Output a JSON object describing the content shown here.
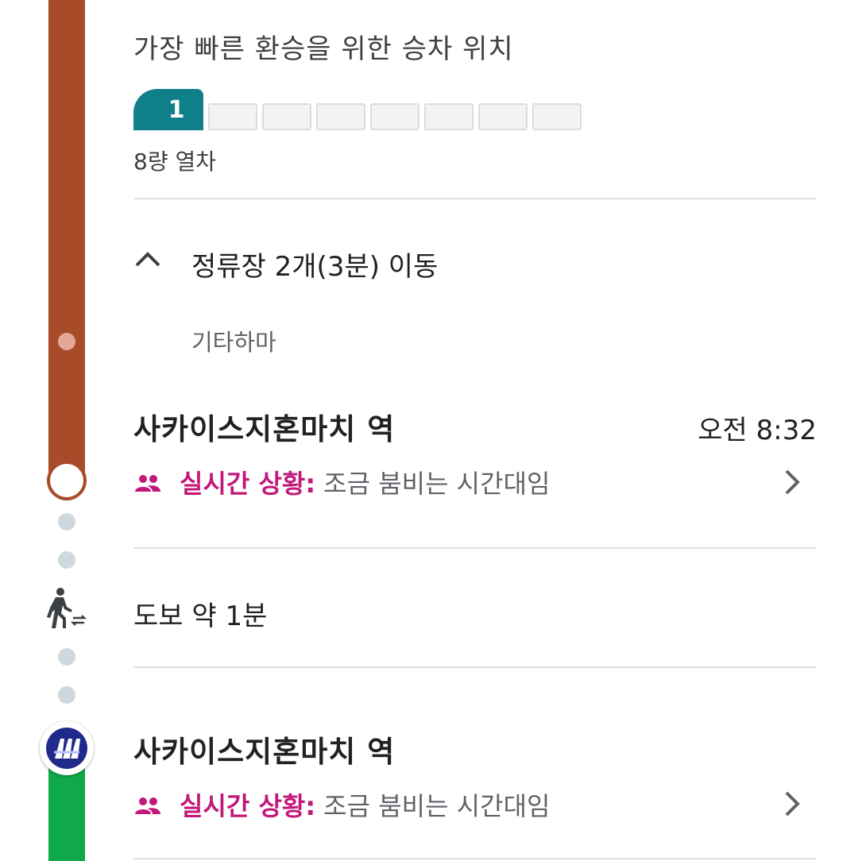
{
  "boarding_section": {
    "title": "가장 빠른 환승을 위한 승차 위치",
    "highlighted_car": "1",
    "total_cars": 8,
    "cars_label": "8량 열차"
  },
  "intermediate": {
    "toggle_label": "정류장 2개(3분) 이동",
    "stops": [
      "기타하마"
    ]
  },
  "arrival_stop": {
    "name": "사카이스지혼마치 역",
    "time": "오전 8:32",
    "status_label": "실시간 상황:",
    "status_value": "조금 붐비는 시간대임"
  },
  "walk": {
    "label": "도보 약 1분"
  },
  "transfer_stop": {
    "name": "사카이스지혼마치 역",
    "status_label": "실시간 상황:",
    "status_value": "조금 붐비는 시간대임"
  },
  "colors": {
    "line_brown": "#a84b29",
    "line_green": "#0fa84a",
    "car_highlight": "#0f7f8a",
    "status_accent": "#c2187a"
  },
  "icons": {
    "collapse": "chevron-up-icon",
    "crowd": "people-icon",
    "walk": "walk-transfer-icon",
    "metro": "osaka-metro-icon",
    "more": "chevron-right-icon"
  }
}
